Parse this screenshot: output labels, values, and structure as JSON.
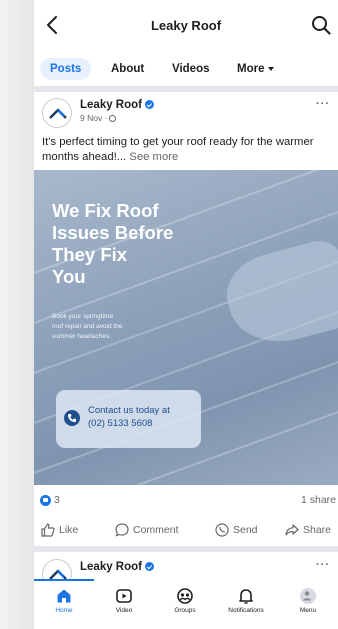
{
  "header": {
    "title": "Leaky Roof"
  },
  "tabs": [
    {
      "label": "Posts"
    },
    {
      "label": "About"
    },
    {
      "label": "Videos"
    },
    {
      "label": "More"
    }
  ],
  "post": {
    "page_name": "Leaky Roof",
    "date": "9 Nov ·",
    "caption": "It's perfect timing to get your roof ready for the warmer months ahead!...",
    "see_more": "See more",
    "image": {
      "headline": "We Fix Roof\nIssues Before\nThey Fix\nYou",
      "subline": "Book your springtime\nroof repair and avoid the\nsummer headaches.",
      "contact": "Contact us today at\n(02) 5133 5608"
    },
    "reaction_count": "3",
    "shares": "1 share",
    "actions": {
      "like": "Like",
      "comment": "Comment",
      "send": "Send",
      "share": "Share"
    }
  },
  "next_post": {
    "page_name": "Leaky Roof"
  },
  "bottom_nav": [
    {
      "label": "Home",
      "icon": "home-icon"
    },
    {
      "label": "Video",
      "icon": "video-icon"
    },
    {
      "label": "Groups",
      "icon": "groups-icon"
    },
    {
      "label": "Notifications",
      "icon": "bell-icon"
    },
    {
      "label": "Menu",
      "icon": "menu-icon"
    }
  ],
  "colors": {
    "accent": "#1b74e4",
    "text": "#1c1e21",
    "muted": "#65676b"
  }
}
